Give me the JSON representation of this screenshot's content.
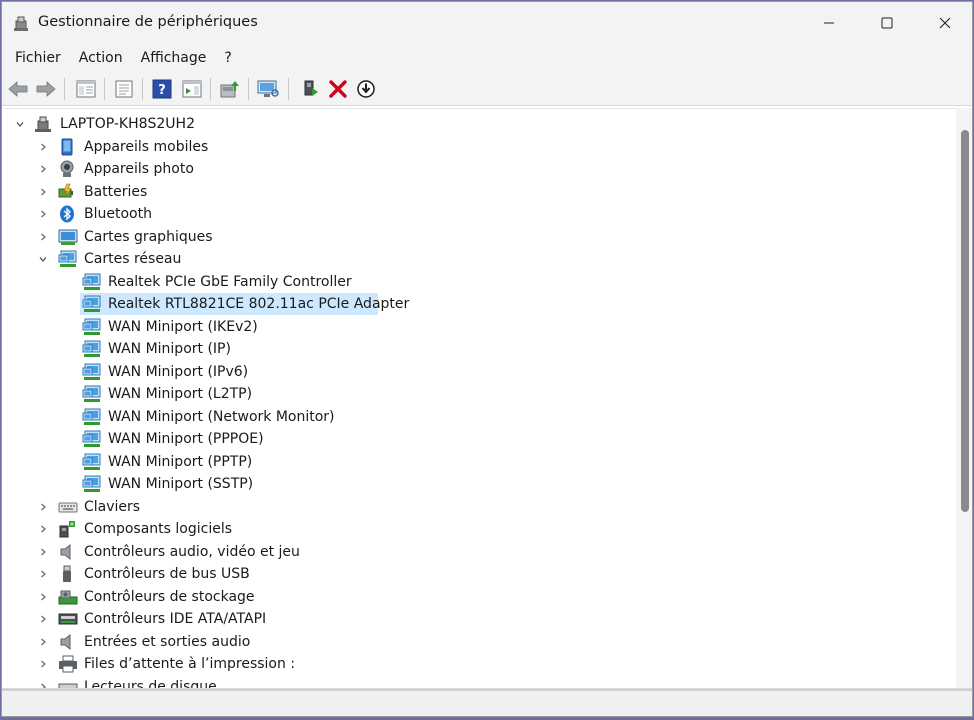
{
  "window": {
    "title": "Gestionnaire de périphériques",
    "controls": {
      "minimize": "─",
      "maximize": "☐",
      "close": "✕"
    }
  },
  "menu": [
    "Fichier",
    "Action",
    "Affichage",
    "?"
  ],
  "toolbar": {
    "buttons": [
      "back-arrow-icon",
      "forward-arrow-icon",
      "console-tree-icon",
      "properties-icon",
      "help-icon",
      "action-pane-icon",
      "update-driver-icon",
      "scan-hardware-icon",
      "add-legacy-icon",
      "uninstall-icon",
      "disable-icon"
    ]
  },
  "tree": {
    "root": "LAPTOP-KH8S2UH2",
    "categories": [
      {
        "label": "Appareils mobiles",
        "icon": "mobile-device-icon",
        "expanded": false
      },
      {
        "label": "Appareils photo",
        "icon": "camera-icon",
        "expanded": false
      },
      {
        "label": "Batteries",
        "icon": "battery-icon",
        "expanded": false
      },
      {
        "label": "Bluetooth",
        "icon": "bluetooth-icon",
        "expanded": false
      },
      {
        "label": "Cartes graphiques",
        "icon": "display-adapter-icon",
        "expanded": false
      },
      {
        "label": "Cartes réseau",
        "icon": "network-adapter-icon",
        "expanded": true,
        "children": [
          "Realtek PCIe GbE Family Controller",
          "Realtek RTL8821CE 802.11ac PCIe Adapter",
          "WAN Miniport (IKEv2)",
          "WAN Miniport (IP)",
          "WAN Miniport (IPv6)",
          "WAN Miniport (L2TP)",
          "WAN Miniport (Network Monitor)",
          "WAN Miniport (PPPOE)",
          "WAN Miniport (PPTP)",
          "WAN Miniport (SSTP)"
        ],
        "selected_child": 1
      },
      {
        "label": "Claviers",
        "icon": "keyboard-icon",
        "expanded": false
      },
      {
        "label": "Composants logiciels",
        "icon": "software-component-icon",
        "expanded": false
      },
      {
        "label": "Contrôleurs audio, vidéo et jeu",
        "icon": "speaker-icon",
        "expanded": false
      },
      {
        "label": "Contrôleurs de bus USB",
        "icon": "usb-icon",
        "expanded": false
      },
      {
        "label": "Contrôleurs de stockage",
        "icon": "storage-controller-icon",
        "expanded": false
      },
      {
        "label": "Contrôleurs IDE ATA/ATAPI",
        "icon": "ide-controller-icon",
        "expanded": false
      },
      {
        "label": "Entrées et sorties audio",
        "icon": "audio-io-icon",
        "expanded": false
      },
      {
        "label": "Files d’attente à l’impression :",
        "icon": "printer-icon",
        "expanded": false
      },
      {
        "label": "Lecteurs de disque",
        "icon": "disk-drive-icon",
        "expanded": false
      }
    ]
  },
  "colors": {
    "selection": "#cde8ff",
    "chrome": "#f3f3f3",
    "delete_red": "#d0021b"
  }
}
